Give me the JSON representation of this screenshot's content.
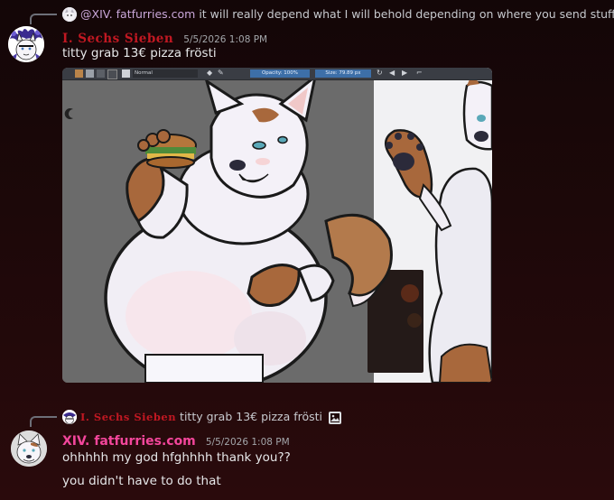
{
  "message1": {
    "reply": {
      "mention": "@XIV. fatfurries.com",
      "text": "it will really depend what I will behold depending on where you send stuff"
    },
    "username": "I. Sechs Sieben",
    "timestamp": "5/5/2026 1:08 PM",
    "content": "titty grab 13€ pizza frösti",
    "attachment": {
      "toolbar": {
        "blend_mode": "Normal",
        "opacity": "Opacity: 100%",
        "size": "Size: 79.89 px"
      }
    }
  },
  "message2": {
    "reply": {
      "username": "I. Sechs Sieben",
      "text": "titty grab 13€ pizza frösti"
    },
    "username": "XIV. fatfurries.com",
    "timestamp": "5/5/2026 1:08 PM",
    "lines": [
      "ohhhhh my god hfghhhh thank you??",
      "you didn't have to do that"
    ]
  },
  "colors": {
    "gothic_username": "#c11822",
    "pink_username": "#f3469b",
    "background": "#1d0809"
  }
}
